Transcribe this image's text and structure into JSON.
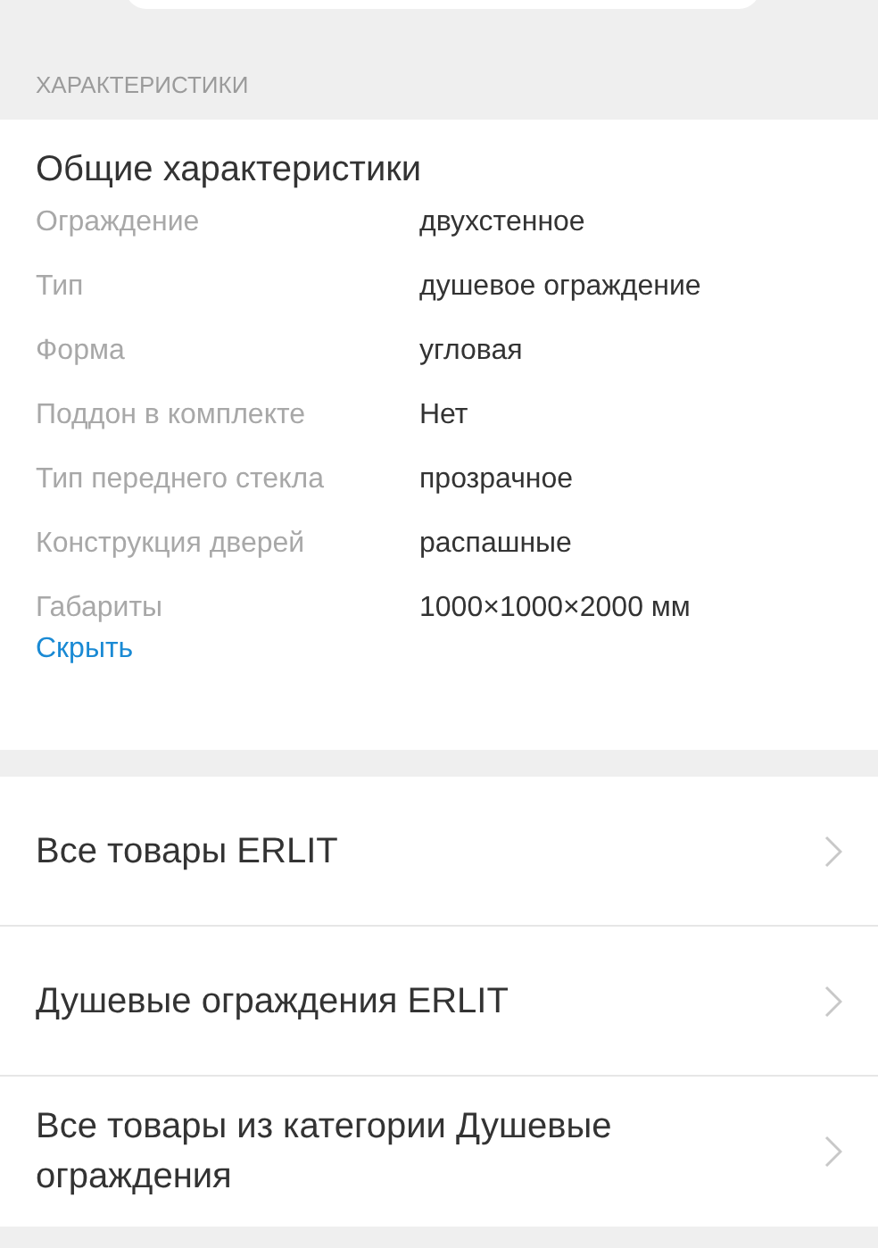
{
  "section_header": "ХАРАКТЕРИСТИКИ",
  "specs": {
    "title": "Общие характеристики",
    "rows": [
      {
        "label": "Ограждение",
        "value": "двухстенное"
      },
      {
        "label": "Тип",
        "value": "душевое ограждение"
      },
      {
        "label": "Форма",
        "value": "угловая"
      },
      {
        "label": "Поддон в комплекте",
        "value": "Нет"
      },
      {
        "label": "Тип переднего стекла",
        "value": "прозрачное"
      },
      {
        "label": "Конструкция дверей",
        "value": "распашные"
      },
      {
        "label": "Габариты",
        "value": "1000×1000×2000 мм"
      }
    ],
    "toggle_link": "Скрыть"
  },
  "links": [
    "Все товары ERLIT",
    "Душевые ограждения ERLIT",
    "Все товары из категории Душевые ограждения"
  ]
}
